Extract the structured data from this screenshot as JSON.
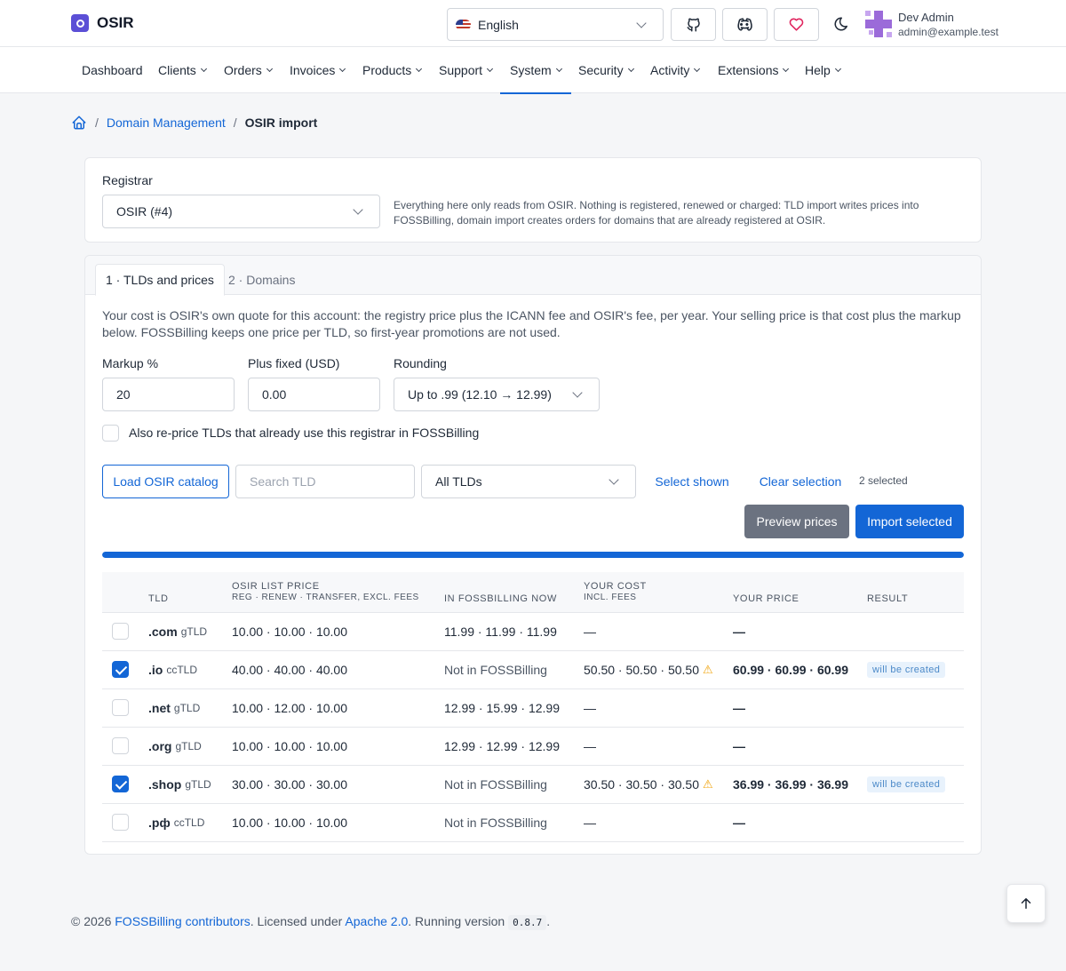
{
  "brand": {
    "name": "OSIR"
  },
  "language": {
    "selected": "English"
  },
  "user": {
    "name": "Dev Admin",
    "email": "admin@example.test"
  },
  "nav": [
    {
      "label": "Dashboard",
      "dropdown": false,
      "active": false
    },
    {
      "label": "Clients",
      "dropdown": true,
      "active": false
    },
    {
      "label": "Orders",
      "dropdown": true,
      "active": false
    },
    {
      "label": "Invoices",
      "dropdown": true,
      "active": false
    },
    {
      "label": "Products",
      "dropdown": true,
      "active": false
    },
    {
      "label": "Support",
      "dropdown": true,
      "active": false
    },
    {
      "label": "System",
      "dropdown": true,
      "active": true
    },
    {
      "label": "Security",
      "dropdown": true,
      "active": false
    },
    {
      "label": "Activity",
      "dropdown": true,
      "active": false
    },
    {
      "label": "Extensions",
      "dropdown": true,
      "active": false
    },
    {
      "label": "Help",
      "dropdown": true,
      "active": false
    }
  ],
  "breadcrumb": {
    "parent": "Domain Management",
    "current": "OSIR import"
  },
  "registrar": {
    "label": "Registrar",
    "selected": "OSIR (#4)",
    "note": "Everything here only reads from OSIR. Nothing is registered, renewed or charged: TLD import writes prices into FOSSBilling, domain import creates orders for domains that are already registered at OSIR."
  },
  "tabs": [
    {
      "label": "1 · TLDs and prices",
      "active": true
    },
    {
      "label": "2 · Domains",
      "active": false
    }
  ],
  "pricing": {
    "description": "Your cost is OSIR's own quote for this account: the registry price plus the ICANN fee and OSIR's fee, per year. Your selling price is that cost plus the markup below. FOSSBilling keeps one price per TLD, so first-year promotions are not used.",
    "markup_label": "Markup %",
    "markup_value": "20",
    "fixed_label": "Plus fixed (USD)",
    "fixed_value": "0.00",
    "rounding_label": "Rounding",
    "rounding_value": "Up to .99 (12.10 → 12.99)",
    "reprice_label": "Also re-price TLDs that already use this registrar in FOSSBilling",
    "reprice_checked": false
  },
  "toolbar": {
    "load_label": "Load OSIR catalog",
    "search_placeholder": "Search TLD",
    "filter_selected": "All TLDs",
    "select_shown_label": "Select shown",
    "clear_selection_label": "Clear selection",
    "selected_count": "2 selected",
    "preview_label": "Preview prices",
    "import_label": "Import selected",
    "progress": 1.0
  },
  "table": {
    "headers": {
      "tld": "TLD",
      "list_price": "OSIR list price",
      "list_price_sub": "Reg · Renew · Transfer, excl. fees",
      "in_fossbilling": "In FOSSBilling now",
      "cost": "Your cost",
      "cost_sub": "incl. fees",
      "price": "Your price",
      "result": "Result"
    },
    "rows": [
      {
        "checked": false,
        "tld": ".com",
        "kind": "gTLD",
        "list": "10.00 · 10.00 · 10.00",
        "current": "11.99 · 11.99 · 11.99",
        "current_muted": false,
        "cost": "—",
        "cost_warn": false,
        "price": "—",
        "result": ""
      },
      {
        "checked": true,
        "tld": ".io",
        "kind": "ccTLD",
        "list": "40.00 · 40.00 · 40.00",
        "current": "Not in FOSSBilling",
        "current_muted": true,
        "cost": "50.50 · 50.50 · 50.50",
        "cost_warn": true,
        "price": "60.99 · 60.99 · 60.99",
        "result": "will be created"
      },
      {
        "checked": false,
        "tld": ".net",
        "kind": "gTLD",
        "list": "10.00 · 12.00 · 10.00",
        "current": "12.99 · 15.99 · 12.99",
        "current_muted": false,
        "cost": "—",
        "cost_warn": false,
        "price": "—",
        "result": ""
      },
      {
        "checked": false,
        "tld": ".org",
        "kind": "gTLD",
        "list": "10.00 · 10.00 · 10.00",
        "current": "12.99 · 12.99 · 12.99",
        "current_muted": false,
        "cost": "—",
        "cost_warn": false,
        "price": "—",
        "result": ""
      },
      {
        "checked": true,
        "tld": ".shop",
        "kind": "gTLD",
        "list": "30.00 · 30.00 · 30.00",
        "current": "Not in FOSSBilling",
        "current_muted": true,
        "cost": "30.50 · 30.50 · 30.50",
        "cost_warn": true,
        "price": "36.99 · 36.99 · 36.99",
        "result": "will be created"
      },
      {
        "checked": false,
        "tld": ".рф",
        "kind": "ccTLD",
        "list": "10.00 · 10.00 · 10.00",
        "current": "Not in FOSSBilling",
        "current_muted": true,
        "cost": "—",
        "cost_warn": false,
        "price": "—",
        "result": ""
      }
    ]
  },
  "footer": {
    "copyright": "© 2026",
    "contributors": "FOSSBilling contributors",
    "licensed": ". Licensed under",
    "license": "Apache 2.0",
    "running": ". Running version",
    "version": "0.8.7",
    "end": "."
  },
  "colors": {
    "accent": "#1366d6",
    "brand": "#5b4fd6",
    "warning": "#f0a30a",
    "secondary": "#6b7280"
  }
}
